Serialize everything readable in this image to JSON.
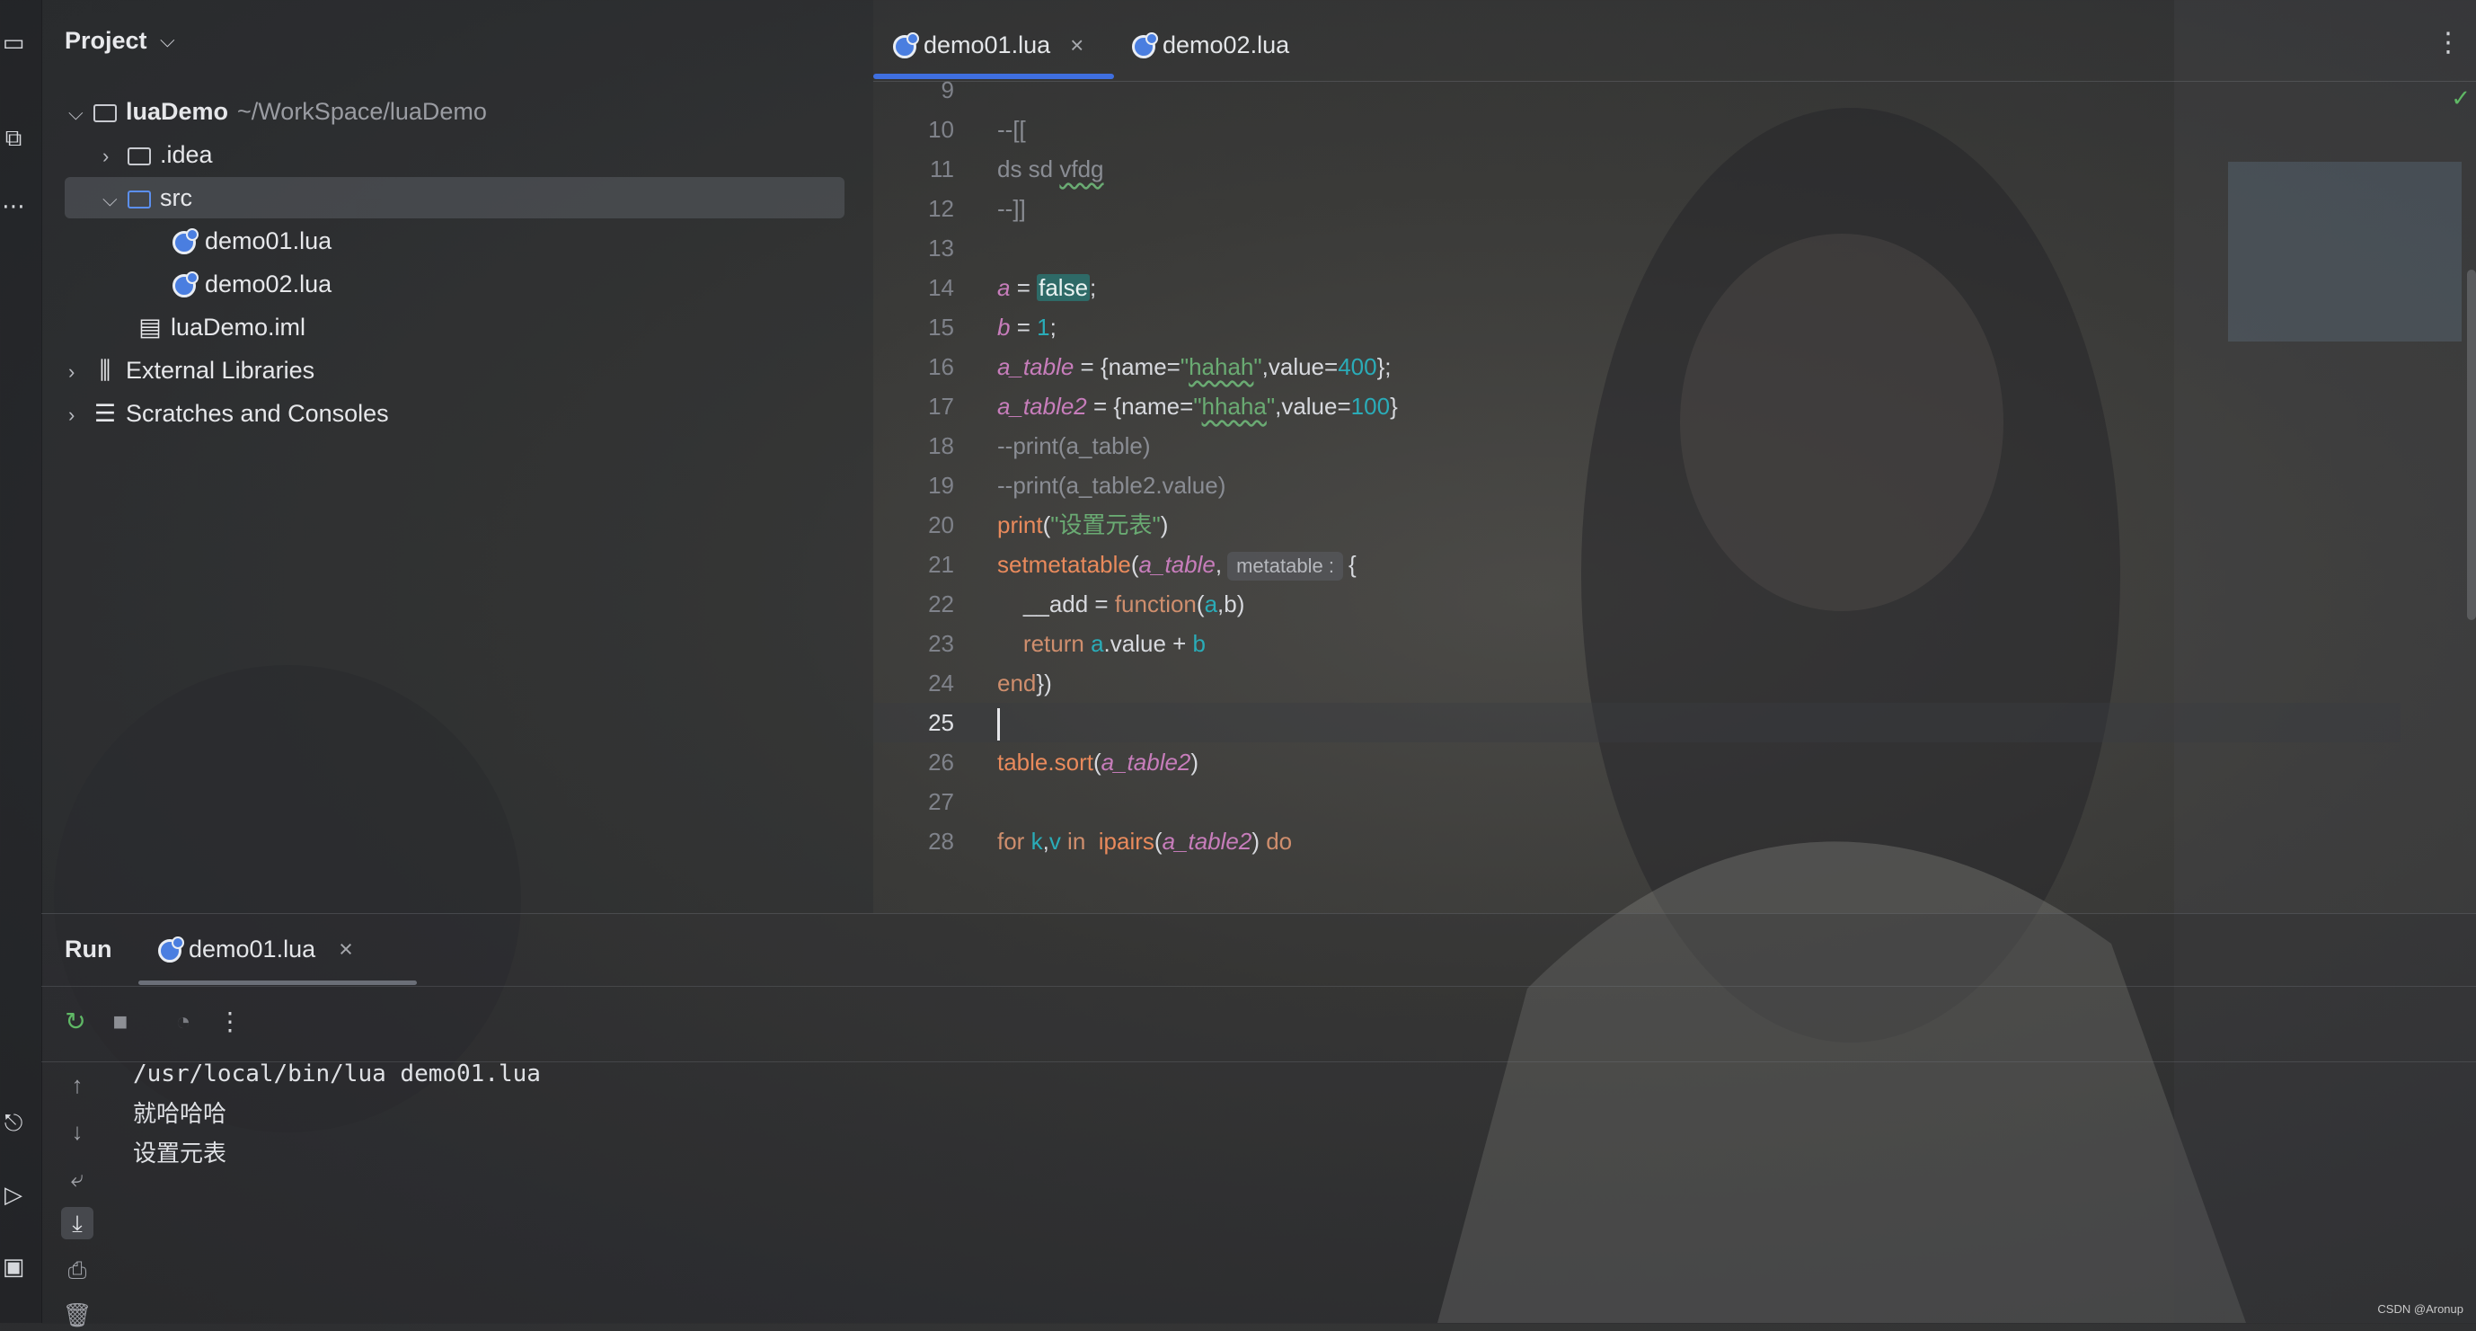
{
  "project": {
    "title": "Project",
    "tree": [
      {
        "label": "luaDemo",
        "hint": "~/WorkSpace/luaDemo"
      },
      {
        "label": ".idea"
      },
      {
        "label": "src"
      },
      {
        "label": "demo01.lua"
      },
      {
        "label": "demo02.lua"
      },
      {
        "label": "luaDemo.iml"
      },
      {
        "label": "External Libraries"
      },
      {
        "label": "Scratches and Consoles"
      }
    ]
  },
  "editor": {
    "tabs": [
      {
        "label": "demo01.lua",
        "active": true
      },
      {
        "label": "demo02.lua",
        "active": false
      }
    ],
    "lines": [
      {
        "num": "9",
        "text": ""
      },
      {
        "num": "10",
        "text": "--[["
      },
      {
        "num": "11",
        "text": "ds sd vfdg"
      },
      {
        "num": "12",
        "text": "--]]"
      },
      {
        "num": "13",
        "text": ""
      },
      {
        "num": "14",
        "text": "a = false;"
      },
      {
        "num": "15",
        "text": "b = 1;"
      },
      {
        "num": "16",
        "text": "a_table = {name=\"hahah\",value=400};"
      },
      {
        "num": "17",
        "text": "a_table2 = {name=\"hhaha\",value=100}"
      },
      {
        "num": "18",
        "text": "--print(a_table)"
      },
      {
        "num": "19",
        "text": "--print(a_table2.value)"
      },
      {
        "num": "20",
        "text": "print(\"设置元表\")"
      },
      {
        "num": "21",
        "text": "setmetatable(a_table, {",
        "inlay": "metatable :"
      },
      {
        "num": "22",
        "text": "    __add = function(a,b)"
      },
      {
        "num": "23",
        "text": "    return a.value + b"
      },
      {
        "num": "24",
        "text": "end})"
      },
      {
        "num": "25",
        "text": ""
      },
      {
        "num": "26",
        "text": "table.sort(a_table2)"
      },
      {
        "num": "27",
        "text": ""
      },
      {
        "num": "28",
        "text": "for k,v in  ipairs(a_table2) do"
      }
    ]
  },
  "run": {
    "title": "Run",
    "tab_label": "demo01.lua",
    "console": [
      "/usr/local/bin/lua demo01.lua",
      "就哈哈哈",
      "设置元表"
    ]
  },
  "colors": {
    "accent": "#3f6fe0",
    "keyword": "#cf8e6d",
    "string": "#6aab73",
    "number": "#2aacb8",
    "variable": "#c77dbb",
    "comment": "#8a8d94"
  },
  "watermark": "CSDN @Aronup"
}
